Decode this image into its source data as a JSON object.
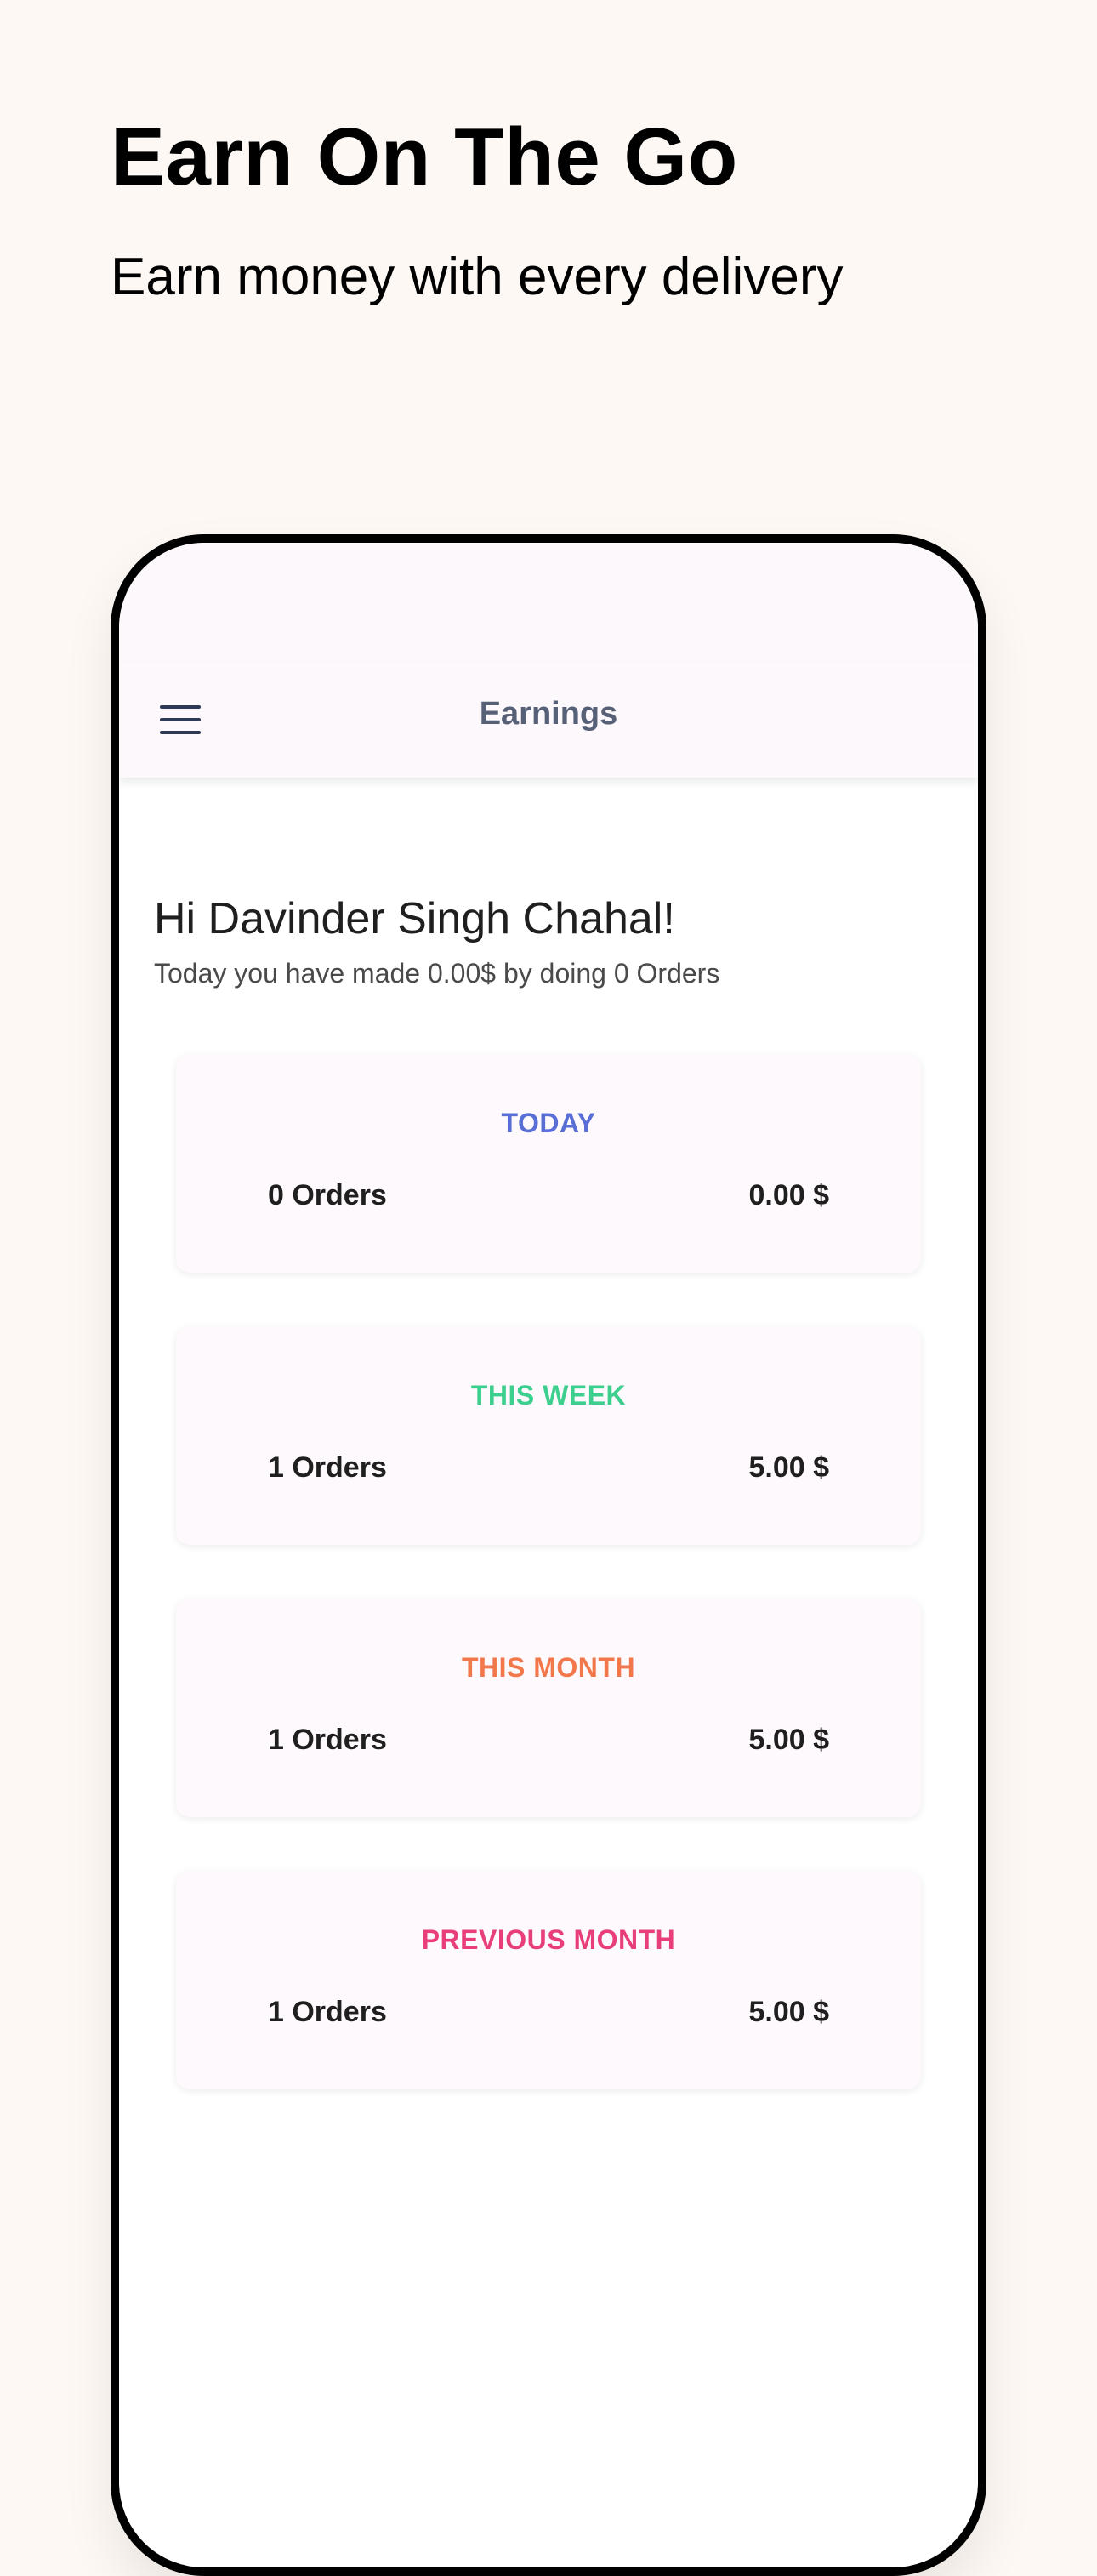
{
  "promo": {
    "title": "Earn On The Go",
    "subtitle": "Earn money with every delivery"
  },
  "app_bar": {
    "title": "Earnings",
    "menu_icon": "hamburger-menu-icon"
  },
  "greeting": {
    "headline": "Hi Davinder Singh Chahal!",
    "summary": "Today you have made 0.00$ by doing 0 Orders"
  },
  "cards": [
    {
      "label": "TODAY",
      "orders": "0 Orders",
      "amount": "0.00 $",
      "color": "#5a6fd6"
    },
    {
      "label": "THIS WEEK",
      "orders": "1 Orders",
      "amount": "5.00 $",
      "color": "#3ccf8e"
    },
    {
      "label": "THIS MONTH",
      "orders": "1 Orders",
      "amount": "5.00 $",
      "color": "#f2784b"
    },
    {
      "label": "PREVIOUS MONTH",
      "orders": "1 Orders",
      "amount": "5.00 $",
      "color": "#e83e7a"
    }
  ],
  "colors": {
    "page_background": "#fdf8f3",
    "app_bar_background": "#fdf8fb",
    "app_title": "#566178",
    "menu_icon": "#2d3a55"
  }
}
